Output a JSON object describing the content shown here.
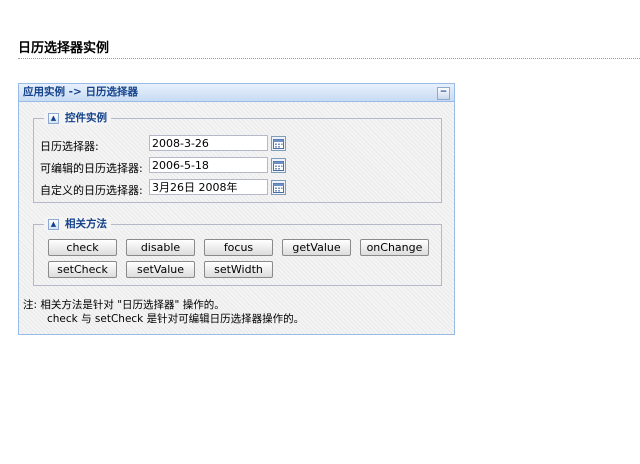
{
  "page": {
    "title": "日历选择器实例"
  },
  "panel": {
    "title": "应用实例 -> 日历选择器",
    "collapse_glyph": "−"
  },
  "controls_fieldset": {
    "legend": "控件实例",
    "toggle_glyph": "▲",
    "fields": [
      {
        "label": "日历选择器:",
        "value": "2008-3-26"
      },
      {
        "label": "可编辑的日历选择器:",
        "value": "2006-5-18"
      },
      {
        "label": "自定义的日历选择器:",
        "value": "3月26日 2008年"
      }
    ]
  },
  "methods_fieldset": {
    "legend": "相关方法",
    "toggle_glyph": "▲",
    "buttons": [
      "check",
      "disable",
      "focus",
      "getValue",
      "onChange",
      "setCheck",
      "setValue",
      "setWidth"
    ]
  },
  "note": {
    "line1": "注: 相关方法是针对 \"日历选择器\" 操作的。",
    "line2": "check 与 setCheck 是针对可编辑日历选择器操作的。"
  },
  "icons": {
    "calendar": "calendar-icon"
  }
}
